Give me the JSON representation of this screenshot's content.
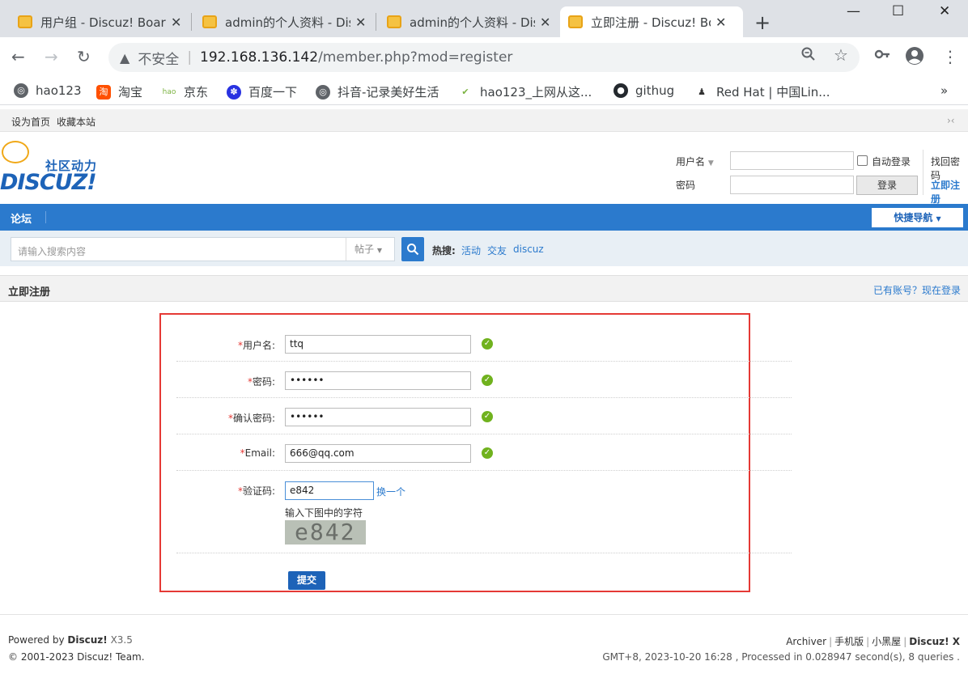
{
  "browser": {
    "tabs": [
      {
        "title": "用户组 - Discuz! Board"
      },
      {
        "title": "admin的个人资料 - Discuz! Board"
      },
      {
        "title": "admin的个人资料 - Discuz! Board"
      },
      {
        "title": "立即注册 - Discuz! Board"
      }
    ],
    "window_controls": {
      "minimize": "—",
      "maximize": "☐",
      "close": "✕"
    },
    "address": {
      "insecure_label": "不安全",
      "host": "192.168.136.142",
      "path": "/member.php?mod=register"
    },
    "bookmarks": [
      {
        "label": "hao123",
        "icon": "globe-icon"
      },
      {
        "label": "淘宝",
        "icon": "taobao-icon"
      },
      {
        "label": "京东",
        "icon": "jd-icon"
      },
      {
        "label": "百度一下",
        "icon": "baidu-icon"
      },
      {
        "label": "抖音-记录美好生活",
        "icon": "globe-icon"
      },
      {
        "label": "hao123_上网从这...",
        "icon": "hao-icon"
      },
      {
        "label": "githug",
        "icon": "github-icon"
      },
      {
        "label": "Red Hat | 中国Lin...",
        "icon": "redhat-icon"
      }
    ],
    "bookmarks_more": "»"
  },
  "topbar": {
    "set_home": "设为首页",
    "bookmark_site": "收藏本站",
    "toggle": "›‹"
  },
  "logo": {
    "cn": "社区动力",
    "en": "DISCUZ!"
  },
  "login": {
    "username_label": "用户名",
    "password_label": "密码",
    "auto_login": "自动登录",
    "login_button": "登录",
    "find_password": "找回密码",
    "register": "立即注册"
  },
  "nav": {
    "forum": "论坛",
    "quick_nav": "快捷导航"
  },
  "search": {
    "placeholder": "请输入搜索内容",
    "type": "帖子",
    "hot_label": "热搜:",
    "hot_items": [
      "活动",
      "交友",
      "discuz"
    ]
  },
  "page": {
    "title": "立即注册",
    "have_account": "已有账号？现在登录"
  },
  "form": {
    "fields": [
      {
        "label": "用户名:",
        "value": "ttq"
      },
      {
        "label": "密码:",
        "value": "••••••"
      },
      {
        "label": "确认密码:",
        "value": "••••••"
      },
      {
        "label": "Email:",
        "value": "666@qq.com"
      }
    ],
    "captcha": {
      "label": "验证码:",
      "value": "e842",
      "refresh": "换一个",
      "hint": "输入下图中的字符",
      "image_text": "e842"
    },
    "submit": "提交",
    "required_mark": "*"
  },
  "footer": {
    "powered_by": "Powered by",
    "brand": "Discuz!",
    "version": "X3.5",
    "copyright": "© 2001-2023",
    "team": "Discuz! Team.",
    "links": [
      "Archiver",
      "手机版",
      "小黑屋"
    ],
    "brand_right": "Discuz! X",
    "status": "GMT+8, 2023-10-20 16:28 , Processed in 0.028947 second(s), 8 queries ."
  }
}
